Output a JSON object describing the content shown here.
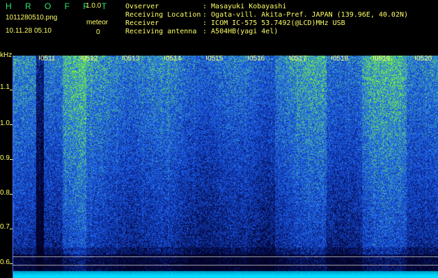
{
  "header": {
    "app_title": "H R O F F T",
    "version": "1.0.0",
    "file_name": "1011280510.png",
    "meteor_label": "meteor",
    "timestamp": "10.11.28 05:10",
    "meteor_count": "0"
  },
  "info": {
    "observer_label": "Ovserver",
    "observer_value": ": Masayuki Kobayashi",
    "location_label": "Receiving Location",
    "location_value": ": Ogata-vill. Akita-Pref. JAPAN (139.96E, 40.02N)",
    "receiver_label": "Receiver",
    "receiver_value": ": ICOM IC-575 53.7492(@LCD)MHz USB",
    "antenna_label": "Receiving antenna",
    "antenna_value": ": A504HB(yagi 4el)"
  },
  "plot": {
    "y_unit": "kHz",
    "y_ticks": [
      "1.1",
      "1.0",
      "0.9",
      "0.8",
      "0.7",
      "0.6"
    ],
    "x_ticks": [
      "0511",
      "0512",
      "0513",
      "0514",
      "0515",
      "0516",
      "0517",
      "0518",
      "0519",
      "0520"
    ],
    "colors": {
      "background": "#000000",
      "text": "#ffff66",
      "title": "#2ee66f",
      "signal_low": "#081a7a",
      "signal_mid": "#1f6bff",
      "signal_high": "#7dff2e",
      "noise_floor": "#00d8ff"
    }
  }
}
